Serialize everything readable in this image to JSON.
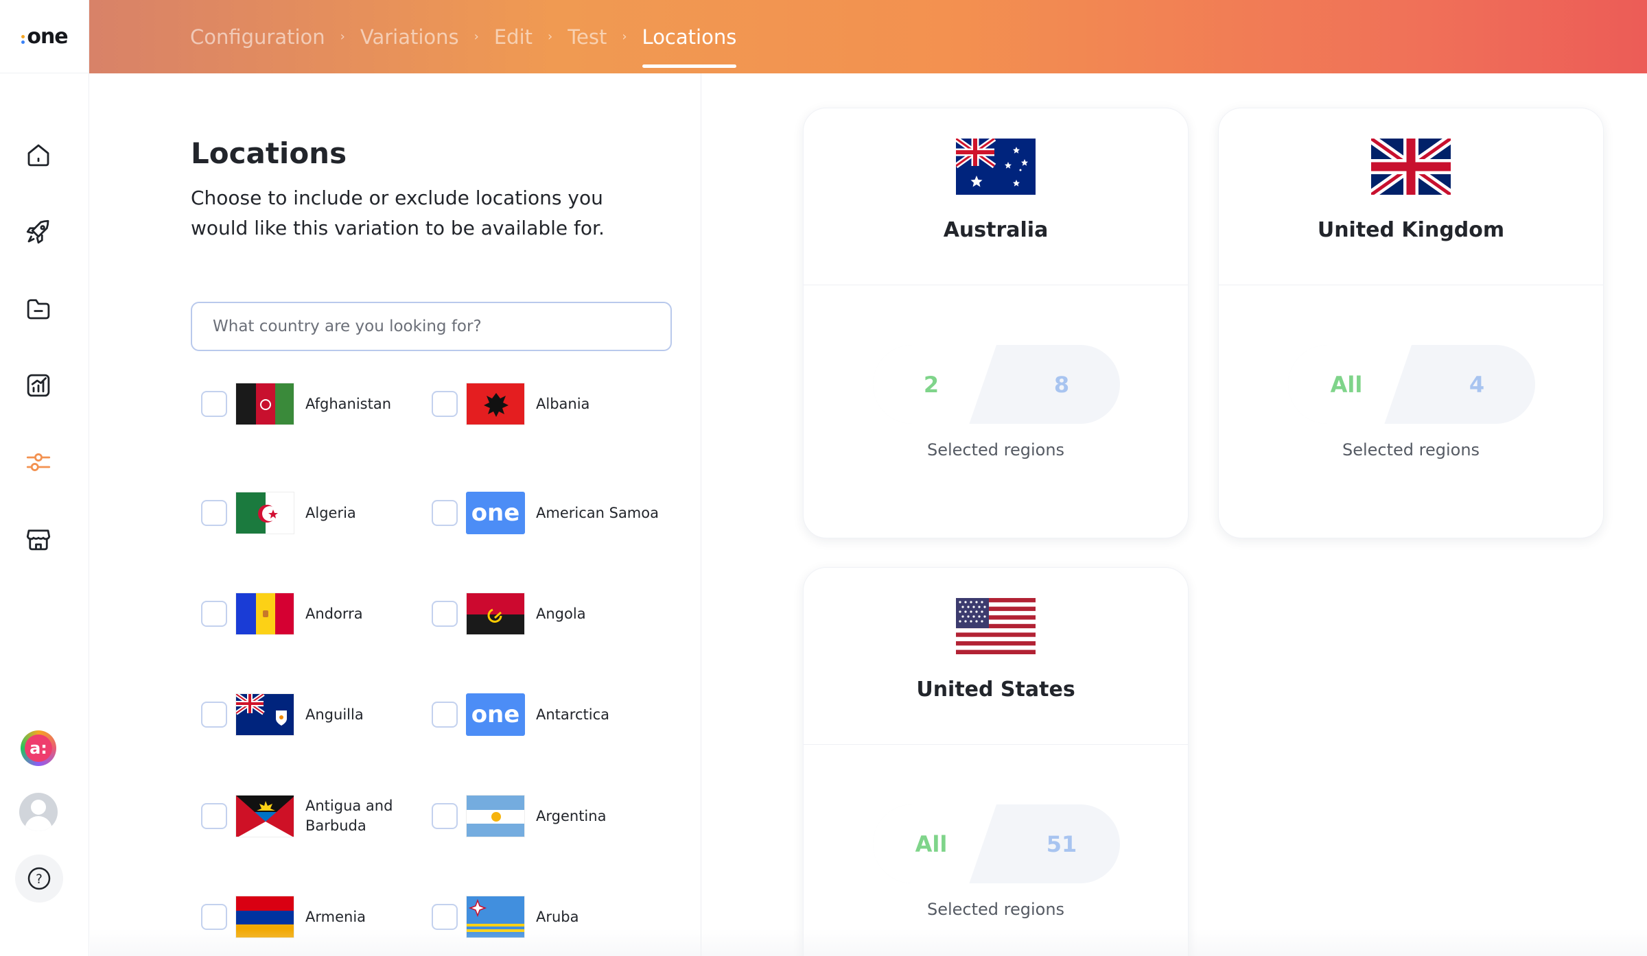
{
  "app": {
    "logo_text": "one",
    "logo_dot_colors": [
      "#f5a623",
      "#3b82f6"
    ]
  },
  "breadcrumbs": [
    {
      "label": "Configuration"
    },
    {
      "label": "Variations"
    },
    {
      "label": "Edit"
    },
    {
      "label": "Test"
    },
    {
      "label": "Locations",
      "active": true
    }
  ],
  "sidebar": {
    "items": [
      {
        "icon": "home-icon"
      },
      {
        "icon": "rocket-icon"
      },
      {
        "icon": "folder-icon"
      },
      {
        "icon": "chart-icon"
      },
      {
        "icon": "sliders-icon",
        "active": true
      },
      {
        "icon": "store-icon"
      }
    ],
    "brand_avatar_text": "a:",
    "help_label": "?"
  },
  "locations": {
    "title": "Locations",
    "description": "Choose to include or exclude locations you would like this variation to be available for.",
    "search_placeholder": "What country are you looking for?",
    "countries": [
      {
        "name": "Afghanistan",
        "flag": "afghanistan"
      },
      {
        "name": "Albania",
        "flag": "albania"
      },
      {
        "name": "Algeria",
        "flag": "algeria"
      },
      {
        "name": "American Samoa",
        "flag": "one",
        "flag_text": "one"
      },
      {
        "name": "Andorra",
        "flag": "andorra"
      },
      {
        "name": "Angola",
        "flag": "angola"
      },
      {
        "name": "Anguilla",
        "flag": "anguilla"
      },
      {
        "name": "Antarctica",
        "flag": "one",
        "flag_text": "one"
      },
      {
        "name": "Antigua and Barbuda",
        "flag": "antigua"
      },
      {
        "name": "Argentina",
        "flag": "argentina"
      },
      {
        "name": "Armenia",
        "flag": "armenia"
      },
      {
        "name": "Aruba",
        "flag": "aruba"
      }
    ]
  },
  "selected": [
    {
      "name": "Australia",
      "flag": "australia",
      "included": "2",
      "excluded": "8",
      "label": "Selected regions"
    },
    {
      "name": "United Kingdom",
      "flag": "uk",
      "included": "All",
      "excluded": "4",
      "label": "Selected regions"
    },
    {
      "name": "United States",
      "flag": "us",
      "included": "All",
      "excluded": "51",
      "label": "Selected regions"
    }
  ],
  "colors": {
    "accent": "#f39150",
    "include_green": "#7fd48a",
    "exclude_blue": "#a8c4f0"
  }
}
